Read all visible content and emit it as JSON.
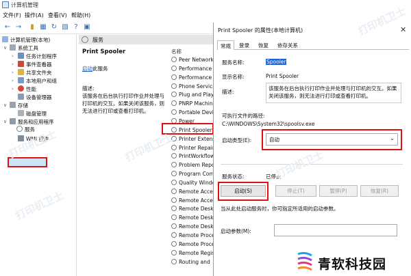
{
  "window": {
    "title": "计算机管理"
  },
  "menu": [
    "文件(F)",
    "操作(A)",
    "查看(V)",
    "帮助(H)"
  ],
  "tree": {
    "root": "计算机管理(本地)",
    "system_tools": "系统工具",
    "task_scheduler": "任务计划程序",
    "event_viewer": "事件查看器",
    "shared_folders": "共享文件夹",
    "local_users": "本地用户和组",
    "performance": "性能",
    "device_manager": "设备管理器",
    "storage": "存储",
    "disk_management": "磁盘管理",
    "services_apps": "服务和应用程序",
    "services": "服务",
    "wmi": "WMI 控件"
  },
  "pane": {
    "header": "服务",
    "selected_name": "Print Spooler",
    "start_link": "启动",
    "start_suffix": "此服务",
    "desc_label": "描述:",
    "description": "该服务在后台执行打印作业并处理与打印机的交互。如果关闭该服务，则无法进行打印或查看打印机。",
    "column_name": "名称"
  },
  "services": [
    "Peer Network",
    "Performance C",
    "Performance",
    "Phone Service",
    "Plug and Play",
    "PNRP Machine",
    "Portable Devi",
    "Power",
    "Print Spooler",
    "Printer Extensi",
    "Printer Repair",
    "PrintWorkflow",
    "Problem Repor",
    "Program Com",
    "Quality Windo",
    "Remote Acces",
    "Remote Acces",
    "Remote Deskt",
    "Remote Deskt",
    "Remote Deskt",
    "Remote Proce",
    "Remote Proce",
    "Remote Regis",
    "Routing and"
  ],
  "dialog": {
    "title": "Print Spooler 的属性(本地计算机)",
    "tabs": [
      "常规",
      "登录",
      "恢复",
      "依存关系"
    ],
    "service_name_label": "服务名称:",
    "service_name": "Spooler",
    "display_name_label": "显示名称:",
    "display_name": "Print Spooler",
    "desc_label": "描述:",
    "description": "该服务在后台执行打印作业并处理与打印机的交互。如果关闭该服务，则无法进行打印或查看打印机。",
    "exe_label": "可执行文件的路径:",
    "exe_path": "C:\\WINDOWS\\System32\\spoolsv.exe",
    "startup_label": "启动类型(E):",
    "startup_value": "自动",
    "status_label": "服务状态:",
    "status_value": "已停止",
    "btn_start": "启动(S)",
    "btn_stop": "停止(T)",
    "btn_pause": "暂停(P)",
    "btn_resume": "恢复(R)",
    "hint": "当从此处启动服务时，你可指定所适用的启动参数。",
    "params_label": "启动参数(M):"
  },
  "watermark": "打印机卫士",
  "brand": "青软科技园",
  "colors": {
    "highlight": "#e01010",
    "selection": "#1e64d6"
  }
}
